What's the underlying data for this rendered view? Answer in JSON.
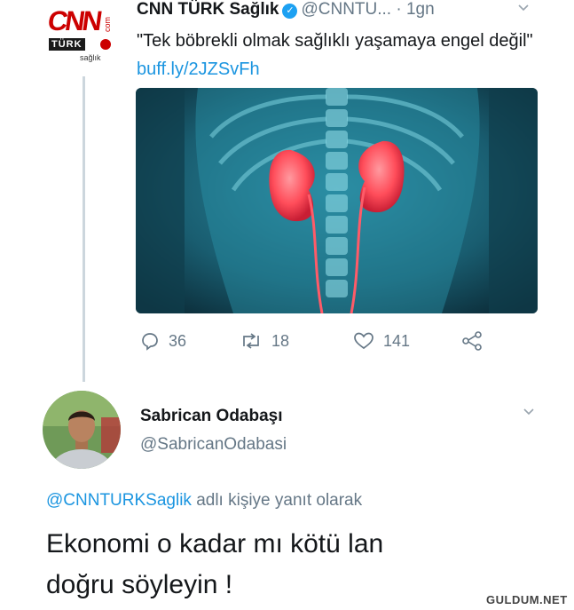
{
  "tweet": {
    "author_name": "CNN TÜRK Sağlık",
    "handle_time": "@CNNTU... · 1gn",
    "text": "\"Tek böbrekli olmak sağlıklı yaşamaya engel değil\"",
    "link": "buff.ly/2JZSvFh",
    "logo": {
      "word": "CNN",
      "dotcom": "com",
      "turk": "TÜRK",
      "sub": "sağlık"
    },
    "media": {
      "subject": "kidneys x-ray illustration",
      "colors": {
        "body": "#1a5a6b",
        "kidney": "#ff4d5a"
      }
    },
    "stats": {
      "replies": "36",
      "retweets": "18",
      "likes": "141"
    }
  },
  "reply": {
    "author_name": "Sabrican Odabaşı",
    "handle": "@SabricanOdabasi",
    "replying_to_handle": "@CNNTURKSaglik",
    "replying_to_suffix": " adlı kişiye yanıt olarak",
    "text_line1": "Ekonomi o kadar mı kötü lan",
    "text_line2": "doğru söyleyin !"
  },
  "watermark": "GULDUM.NET",
  "colors": {
    "link": "#1b95e0",
    "muted": "#657786",
    "verified": "#1da1f2",
    "brand": "#cc0000"
  }
}
